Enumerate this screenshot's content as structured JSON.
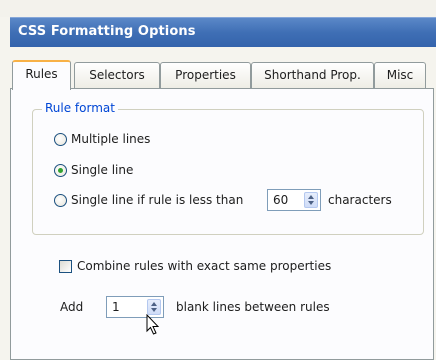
{
  "window": {
    "title": "CSS Formatting Options"
  },
  "tabs": [
    {
      "label": "Rules",
      "active": true
    },
    {
      "label": "Selectors",
      "active": false
    },
    {
      "label": "Properties",
      "active": false
    },
    {
      "label": "Shorthand Prop.",
      "active": false
    },
    {
      "label": "Misc",
      "active": false
    }
  ],
  "rule_format": {
    "legend": "Rule format",
    "options": [
      {
        "label": "Multiple lines",
        "selected": false
      },
      {
        "label": "Single line",
        "selected": true
      },
      {
        "label": "Single line if rule is less than",
        "selected": false
      }
    ],
    "chars_value": "60",
    "chars_suffix": "characters"
  },
  "combine": {
    "label": "Combine rules with exact same properties",
    "checked": false
  },
  "blank_lines": {
    "prefix": "Add",
    "value": "1",
    "suffix": "blank lines between rules"
  },
  "colors": {
    "title_bar": "#3f6fb5",
    "legend_text": "#0046d5",
    "active_tab_accent": "#f8b146",
    "radio_selected": "#31a231"
  },
  "icons": [
    "spin-up-arrow-icon",
    "spin-down-arrow-icon",
    "mouse-pointer-icon"
  ]
}
